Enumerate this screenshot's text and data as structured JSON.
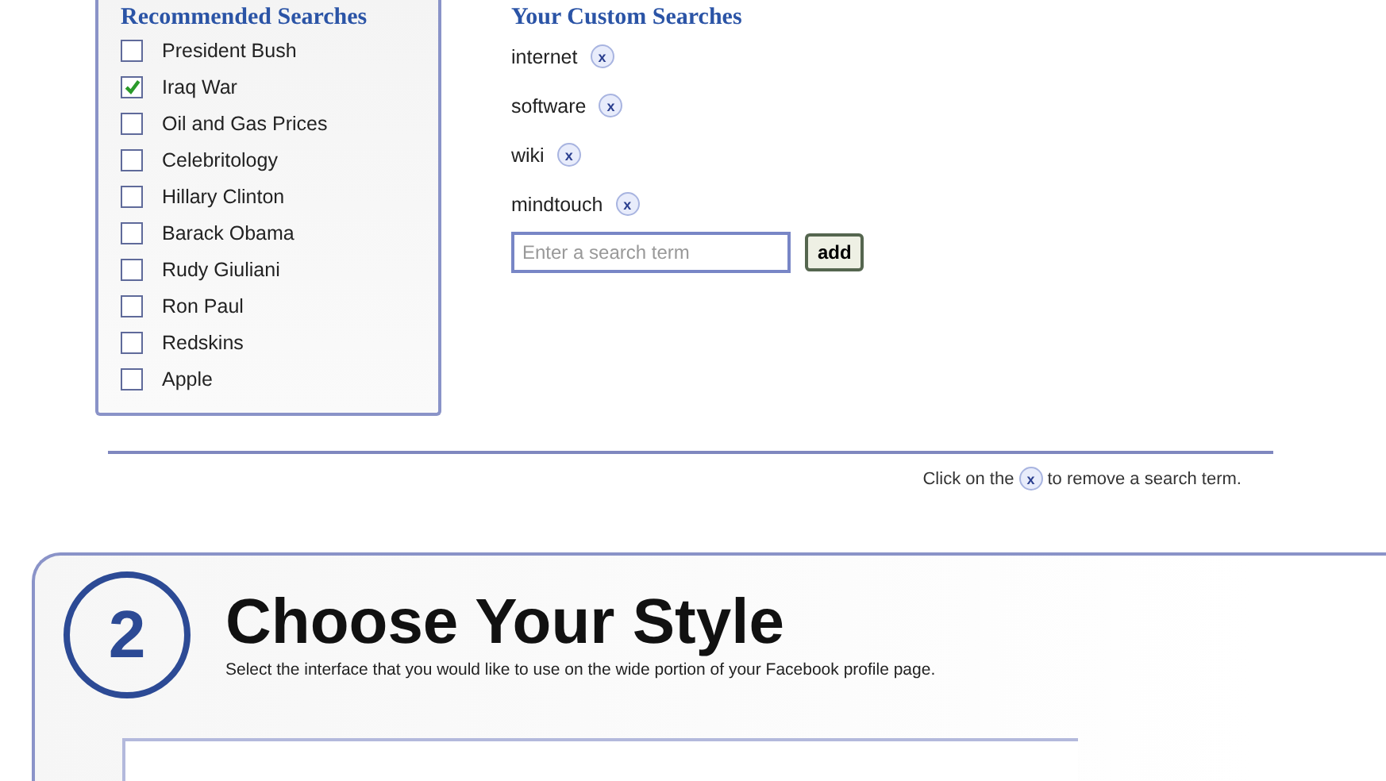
{
  "recommended": {
    "title": "Recommended Searches",
    "items": [
      {
        "label": "President Bush",
        "checked": false
      },
      {
        "label": "Iraq War",
        "checked": true
      },
      {
        "label": "Oil and Gas Prices",
        "checked": false
      },
      {
        "label": "Celebritology",
        "checked": false
      },
      {
        "label": "Hillary Clinton",
        "checked": false
      },
      {
        "label": "Barack Obama",
        "checked": false
      },
      {
        "label": "Rudy Giuliani",
        "checked": false
      },
      {
        "label": "Ron Paul",
        "checked": false
      },
      {
        "label": "Redskins",
        "checked": false
      },
      {
        "label": "Apple",
        "checked": false
      }
    ]
  },
  "custom": {
    "title": "Your Custom Searches",
    "terms": [
      {
        "label": "internet",
        "remove": "x"
      },
      {
        "label": "software",
        "remove": "x"
      },
      {
        "label": "wiki",
        "remove": "x"
      },
      {
        "label": "mindtouch",
        "remove": "x"
      }
    ],
    "search": {
      "placeholder": "Enter a search term"
    },
    "add_button": "add"
  },
  "help": {
    "before": "Click on the",
    "icon": "x",
    "after": "to remove a search term."
  },
  "step": {
    "number": "2",
    "title": "Choose Your Style",
    "subtitle": "Select the interface that you would like to use on the wide portion of your Facebook profile page."
  }
}
